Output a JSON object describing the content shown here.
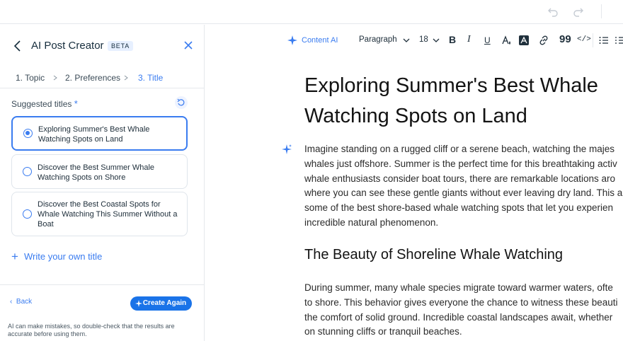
{
  "topbar": {
    "undo_icon": "undo-icon",
    "redo_icon": "redo-icon"
  },
  "panel": {
    "title": "AI Post Creator",
    "badge": "BETA",
    "steps": [
      {
        "label": "1.  Topic"
      },
      {
        "label": "2.  Preferences"
      },
      {
        "label": "3.  Title"
      }
    ],
    "suggested_label": "Suggested titles",
    "required_mark": "*",
    "options": [
      {
        "text": "Exploring Summer's Best Whale Watching Spots on Land",
        "selected": true
      },
      {
        "text": "Discover the Best Summer Whale Watching Spots on Shore",
        "selected": false
      },
      {
        "text": "Discover the Best Coastal Spots for Whale Watching This Summer Without a Boat",
        "selected": false
      }
    ],
    "write_own": "Write your own title",
    "back": "Back",
    "create_again": "Create Again",
    "disclaimer": "AI can make mistakes, so double-check that the results are accurate before using them."
  },
  "toolbar": {
    "content_ai": "Content AI",
    "paragraph": "Paragraph",
    "font_size": "18"
  },
  "document": {
    "title_line1": "Exploring Summer's Best Whale",
    "title_line2": "Watching Spots on Land",
    "intro_lines": [
      "Imagine standing on a rugged cliff or a serene beach, watching the majes",
      "whales just offshore. Summer is the perfect time for this breathtaking activ",
      "whale enthusiasts consider boat tours, there are remarkable locations aro",
      "where you can see these gentle giants without ever leaving dry land. This a",
      "some of the best shore-based whale watching spots that let you experien",
      "incredible natural phenomenon."
    ],
    "heading2": "The Beauty of Shoreline Whale Watching",
    "body_lines": [
      "During summer, many whale species migrate toward warmer waters, ofte",
      "to shore. This behavior gives everyone the chance to witness these beauti",
      "the comfort of solid ground. Incredible coastal landscapes await, whether",
      "on stunning cliffs or tranquil beaches."
    ]
  },
  "colors": {
    "accent": "#3a7cf0",
    "button": "#1a73e8"
  }
}
